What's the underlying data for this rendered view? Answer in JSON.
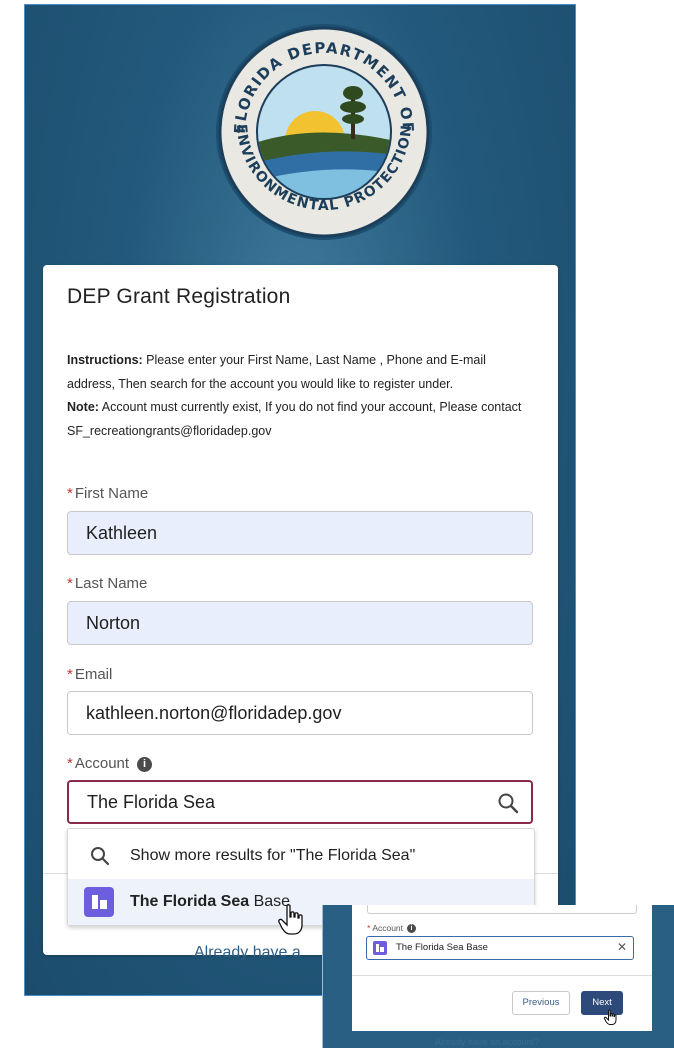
{
  "seal": {
    "text_top": "FLORIDA DEPARTMENT OF",
    "text_bottom": "ENVIRONMENTAL PROTECTION"
  },
  "form": {
    "title": "DEP Grant Registration",
    "instructions_label": "Instructions:",
    "instructions_text": " Please enter your First Name, Last Name , Phone and E-mail address, Then search for the account you would like to register under.",
    "note_label": "Note:",
    "note_text": " Account must currently exist, If you do not find your account, Please contact SF_recreationgrants@floridadep.gov",
    "required_marker": "*",
    "first_name_label": "First Name",
    "first_name_value": "Kathleen",
    "last_name_label": "Last Name",
    "last_name_value": "Norton",
    "email_label": "Email",
    "email_value": "kathleen.norton@floridadep.gov",
    "account_label": "Account",
    "account_value": "The Florida Sea",
    "info_glyph": "i"
  },
  "dropdown": {
    "more_results": "Show more results for \"The Florida Sea\"",
    "match_bold": "The Florida Sea",
    "match_rest": " Base"
  },
  "footer": {
    "already_text": "Already have a"
  },
  "inset": {
    "account_label": "Account",
    "account_value": "The Florida Sea Base",
    "clear_glyph": "✕",
    "previous_label": "Previous",
    "next_label": "Next",
    "already_text": "Already have an account?"
  },
  "colors": {
    "accent": "#2d4a7a",
    "account_icon": "#6d5ee0",
    "required": "#c23934"
  }
}
